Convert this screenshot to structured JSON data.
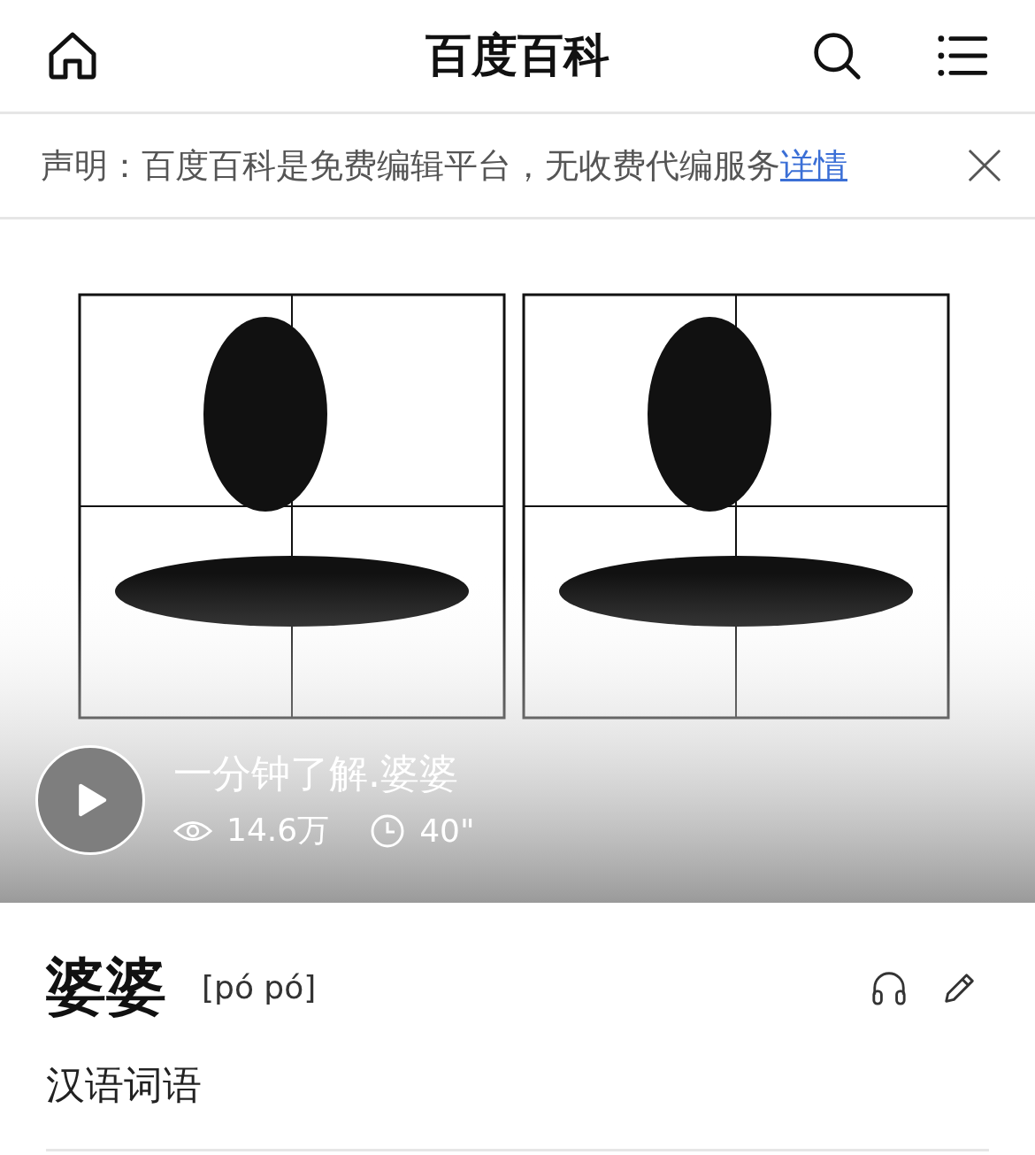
{
  "header": {
    "title": "百度百科"
  },
  "notice": {
    "text": "声明：百度百科是免费编辑平台，无收费代编服务",
    "link": "详情"
  },
  "video": {
    "title": "一分钟了解.婆婆",
    "views": "14.6万",
    "duration": "40\""
  },
  "entry": {
    "title": "婆婆",
    "pinyin": "[pó pó]",
    "description": "汉语词语"
  }
}
